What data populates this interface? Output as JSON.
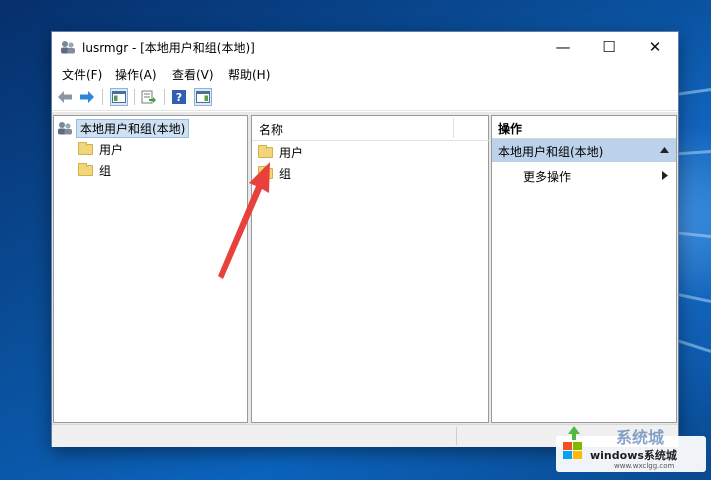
{
  "window": {
    "title": "lusrmgr - [本地用户和组(本地)]",
    "controls": {
      "minimize": "—",
      "maximize": "☐",
      "close": "✕"
    }
  },
  "menu": [
    "文件(F)",
    "操作(A)",
    "查看(V)",
    "帮助(H)"
  ],
  "toolbar": {
    "icons": [
      "back-arrow-icon",
      "forward-arrow-icon",
      "show-hide-tree-icon",
      "export-list-icon",
      "help-icon",
      "show-hide-action-pane-icon"
    ]
  },
  "tree": {
    "root": "本地用户和组(本地)",
    "children": [
      "用户",
      "组"
    ]
  },
  "list": {
    "column_header": "名称",
    "items": [
      "用户",
      "组"
    ]
  },
  "actions": {
    "header": "操作",
    "section": "本地用户和组(本地)",
    "items": [
      "更多操作"
    ]
  },
  "watermark": {
    "logo_text": "windows系统城",
    "url": "www.wxclgg.com",
    "partial_text": "系统城"
  },
  "colors": {
    "selection": "#cfe0f3",
    "action_section": "#bcd2ea",
    "annotation_arrow": "#e8413b",
    "folder": "#f3d67a"
  }
}
